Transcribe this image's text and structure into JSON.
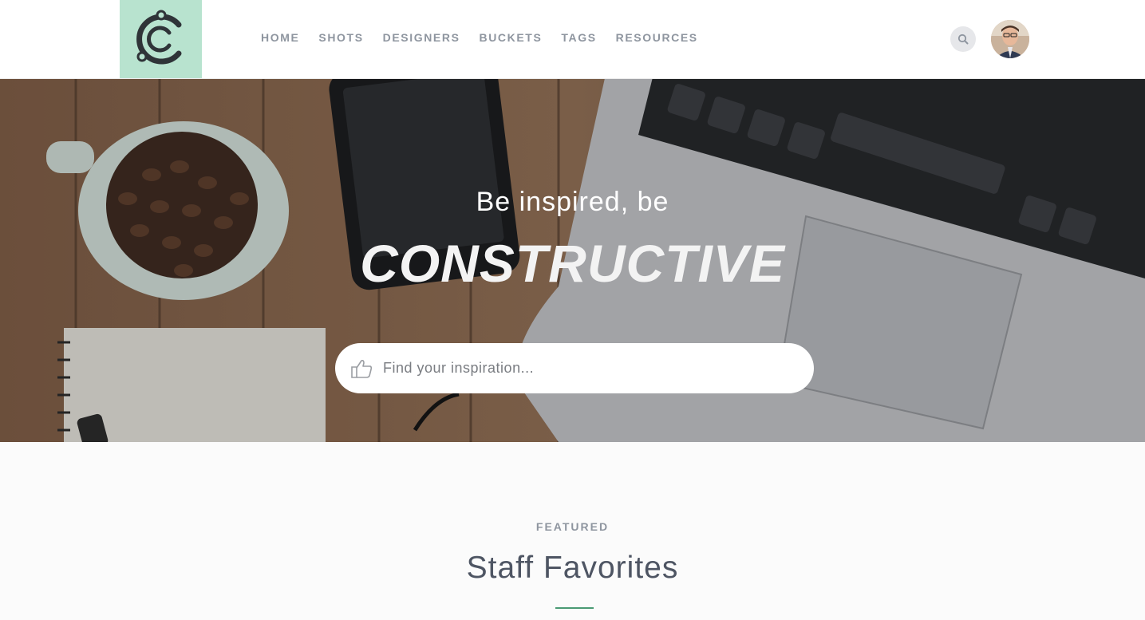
{
  "brand": {
    "logo_icon": "c-circuit-logo",
    "logo_bg": "#b8e3cf"
  },
  "nav": {
    "items": [
      {
        "label": "HOME"
      },
      {
        "label": "SHOTS"
      },
      {
        "label": "DESIGNERS"
      },
      {
        "label": "BUCKETS"
      },
      {
        "label": "TAGS"
      },
      {
        "label": "RESOURCES"
      }
    ]
  },
  "header_actions": {
    "search_icon": "search-icon",
    "avatar": "user-avatar"
  },
  "hero": {
    "subtitle": "Be inspired, be",
    "title": "CONSTRUCTIVE",
    "search_placeholder": "Find your inspiration...",
    "search_icon": "thumbs-up-icon"
  },
  "featured": {
    "eyebrow": "FEATURED",
    "title": "Staff Favorites",
    "accent": "#4a9a74"
  }
}
